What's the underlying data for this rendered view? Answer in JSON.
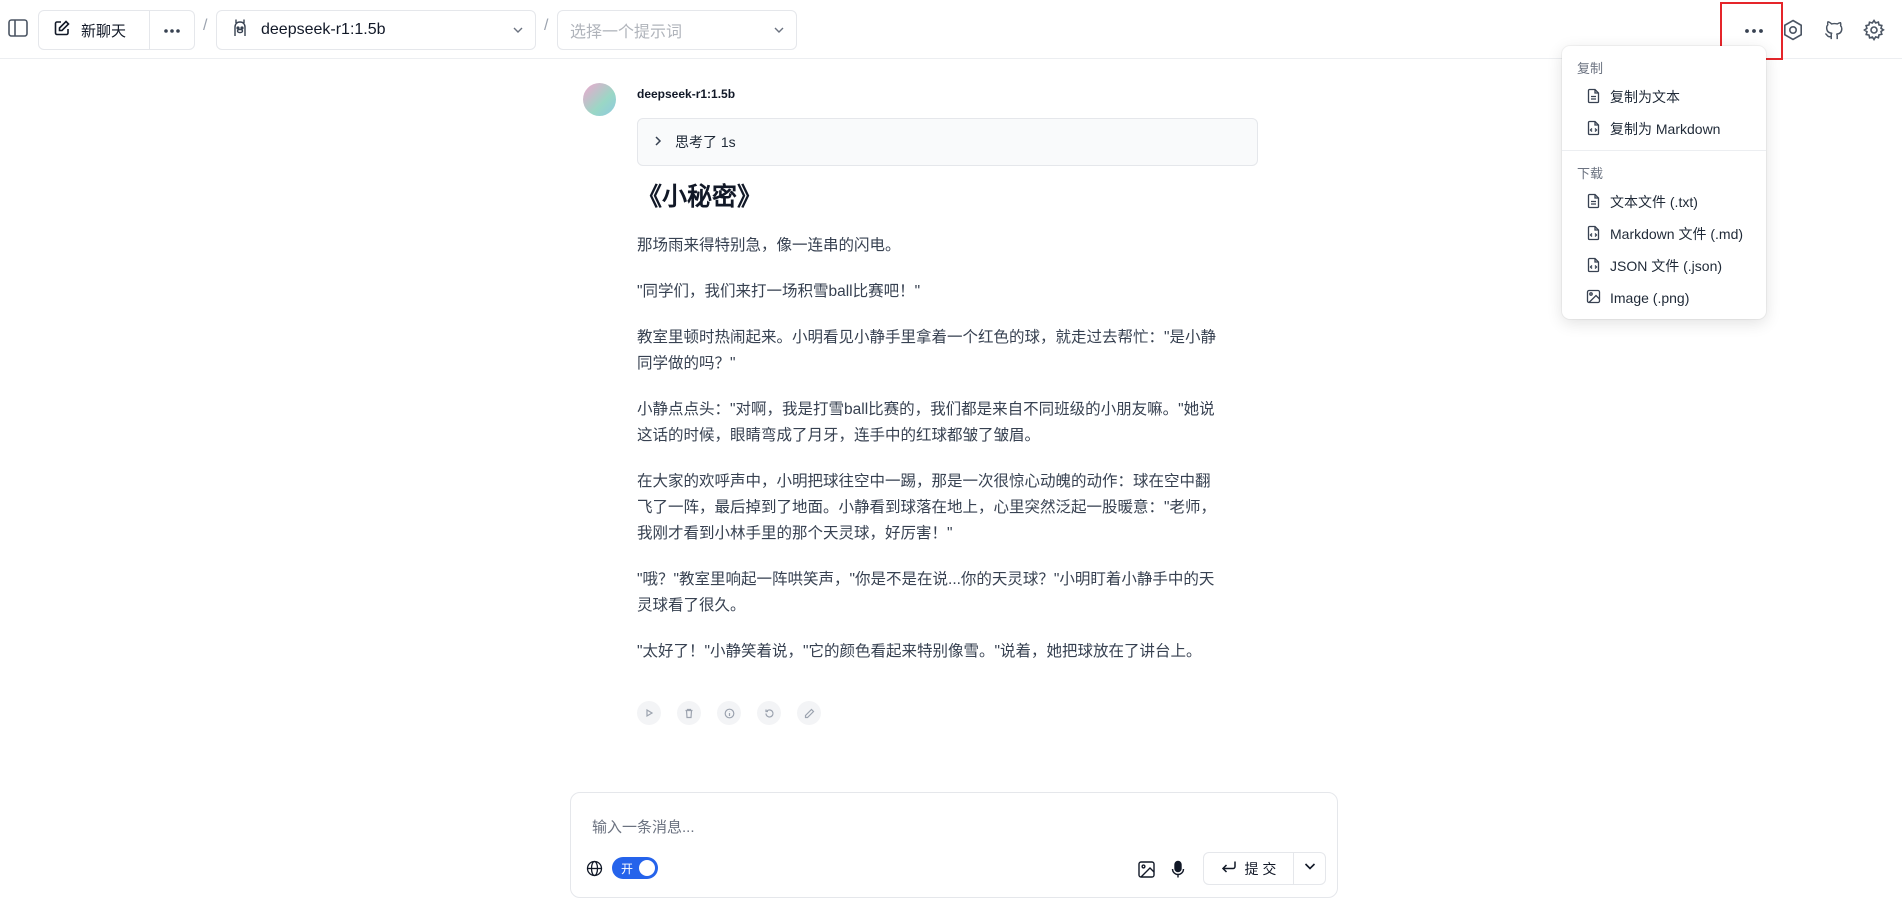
{
  "header": {
    "new_chat_label": "新聊天",
    "separator": "/",
    "model": "deepseek-r1:1.5b",
    "prompt_placeholder": "选择一个提示词"
  },
  "menu": {
    "copy_section": "复制",
    "copy_items": [
      "复制为文本",
      "复制为 Markdown"
    ],
    "download_section": "下载",
    "download_items": [
      "文本文件 (.txt)",
      "Markdown 文件 (.md)",
      "JSON 文件 (.json)",
      "Image (.png)"
    ]
  },
  "message": {
    "author": "deepseek-r1:1.5b",
    "thought_label": "思考了 1s",
    "title": "《小秘密》",
    "paragraphs": [
      "那场雨来得特别急，像一连串的闪电。",
      "\"同学们，我们来打一场积雪ball比赛吧！\"",
      "教室里顿时热闹起来。小明看见小静手里拿着一个红色的球，就走过去帮忙：\"是小静同学做的吗？\"",
      "小静点点头：\"对啊，我是打雪ball比赛的，我们都是来自不同班级的小朋友嘛。\"她说这话的时候，眼睛弯成了月牙，连手中的红球都皱了皱眉。",
      "在大家的欢呼声中，小明把球往空中一踢，那是一次很惊心动魄的动作：球在空中翻飞了一阵，最后掉到了地面。小静看到球落在地上，心里突然泛起一股暖意：\"老师，我刚才看到小林手里的那个天灵球，好厉害！\"",
      "\"哦？\"教室里响起一阵哄笑声，\"你是不是在说...你的天灵球？\"小明盯着小静手中的天灵球看了很久。",
      "\"太好了！\"小静笑着说，\"它的颜色看起来特别像雪。\"说着，她把球放在了讲台上。"
    ]
  },
  "composer": {
    "placeholder": "输入一条消息...",
    "toggle_label": "开",
    "submit_label": "提 交"
  },
  "colors": {
    "accent": "#2563eb",
    "highlight": "#e5252a"
  }
}
